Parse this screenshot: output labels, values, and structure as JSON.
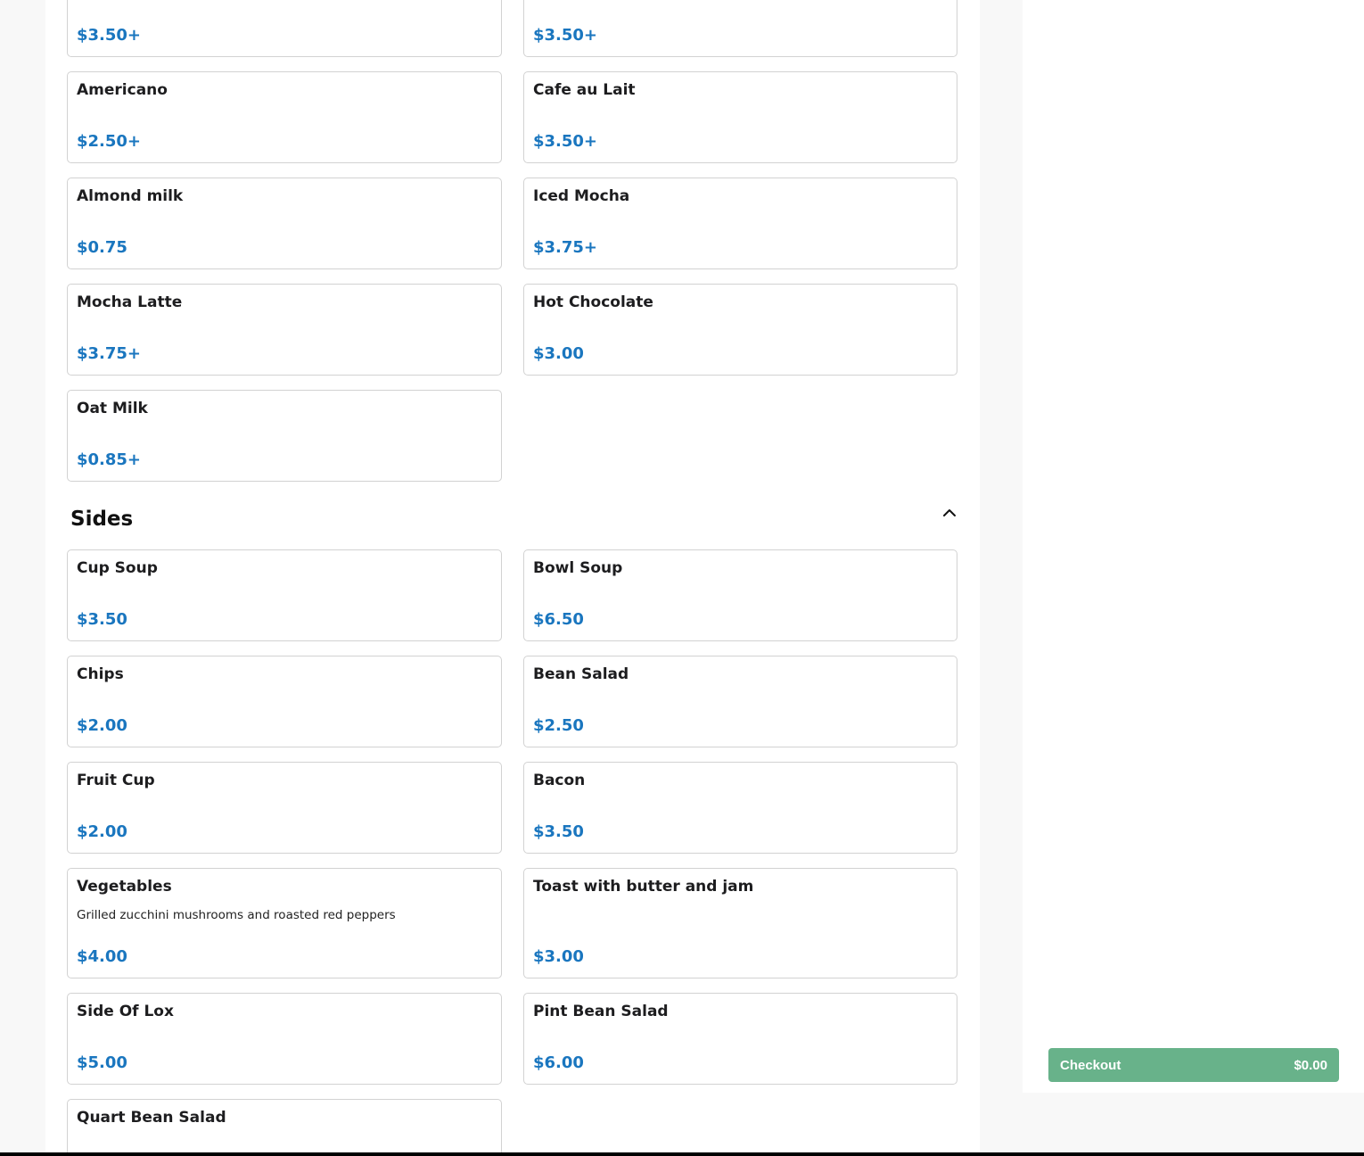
{
  "menu": {
    "top_items": [
      {
        "name": "",
        "price": "$3.50+"
      },
      {
        "name": "",
        "price": "$3.50+"
      },
      {
        "name": "Americano",
        "price": "$2.50+"
      },
      {
        "name": "Cafe au Lait",
        "price": "$3.50+"
      },
      {
        "name": "Almond milk",
        "price": "$0.75"
      },
      {
        "name": "Iced Mocha",
        "price": "$3.75+"
      },
      {
        "name": "Mocha Latte",
        "price": "$3.75+"
      },
      {
        "name": "Hot Chocolate",
        "price": "$3.00"
      },
      {
        "name": "Oat Milk",
        "price": "$0.85+"
      }
    ],
    "sides": {
      "title": "Sides",
      "items": [
        {
          "name": "Cup Soup",
          "price": "$3.50"
        },
        {
          "name": "Bowl Soup",
          "price": "$6.50"
        },
        {
          "name": "Chips",
          "price": "$2.00"
        },
        {
          "name": "Bean Salad",
          "price": "$2.50"
        },
        {
          "name": "Fruit Cup",
          "price": "$2.00"
        },
        {
          "name": "Bacon",
          "price": "$3.50"
        },
        {
          "name": "Vegetables",
          "description": "Grilled zucchini mushrooms and roasted red peppers",
          "price": "$4.00"
        },
        {
          "name": "Toast with butter and jam",
          "price": "$3.00"
        },
        {
          "name": "Side Of Lox",
          "price": "$5.00"
        },
        {
          "name": "Pint Bean Salad",
          "price": "$6.00"
        },
        {
          "name": "Quart Bean Salad",
          "price": ""
        }
      ]
    }
  },
  "cart": {
    "checkout_label": "Checkout",
    "total": "$0.00"
  },
  "icons": {
    "collapse": "chevron-up-icon"
  },
  "colors": {
    "price": "#1a76bf",
    "checkout": "#68b28a"
  }
}
